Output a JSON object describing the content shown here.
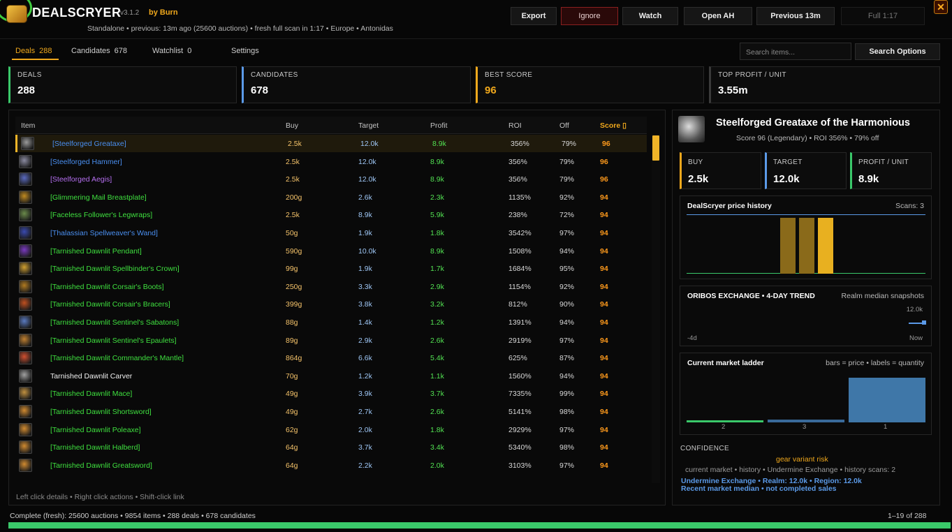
{
  "header": {
    "title": "DEALSCRYER",
    "version": "v3.1.2",
    "author": "by Burn",
    "subtitle": "Standalone • previous: 13m ago (25600 auctions) • fresh full scan in 1:17 • Europe • Antonidas",
    "buttons": {
      "export": "Export",
      "ignore": "Ignore",
      "watch": "Watch",
      "open_ah": "Open AH",
      "previous": "Previous 13m",
      "full": "Full 1:17"
    },
    "close": "✕"
  },
  "tabs": {
    "deals": {
      "label": "Deals",
      "count": "288"
    },
    "candidates": {
      "label": "Candidates",
      "count": "678"
    },
    "watchlist": {
      "label": "Watchlist",
      "count": "0"
    },
    "settings": {
      "label": "Settings"
    }
  },
  "search": {
    "placeholder": "Search items...",
    "options_label": "Search Options"
  },
  "stats": {
    "deals": {
      "label": "DEALS",
      "value": "288"
    },
    "candidates": {
      "label": "CANDIDATES",
      "value": "678"
    },
    "best_score": {
      "label": "BEST SCORE",
      "value": "96"
    },
    "top_profit": {
      "label": "TOP PROFIT / UNIT",
      "value": "3.55m"
    }
  },
  "table": {
    "columns": {
      "item": "Item",
      "buy": "Buy",
      "target": "Target",
      "profit": "Profit",
      "roi": "ROI",
      "off": "Off",
      "score": "Score"
    },
    "sort_indicator": "▯",
    "rows": [
      {
        "name": "[Steelforged Greataxe]",
        "quality": "rare",
        "icon": "greataxe-icon",
        "buy": "2.5k",
        "target": "12.0k",
        "profit": "8.9k",
        "roi": "356%",
        "off": "79%",
        "score": "96"
      },
      {
        "name": "[Steelforged Hammer]",
        "quality": "rare",
        "icon": "hammer-icon",
        "buy": "2.5k",
        "target": "12.0k",
        "profit": "8.9k",
        "roi": "356%",
        "off": "79%",
        "score": "96"
      },
      {
        "name": "[Steelforged Aegis]",
        "quality": "epic",
        "icon": "shield-icon",
        "buy": "2.5k",
        "target": "12.0k",
        "profit": "8.9k",
        "roi": "356%",
        "off": "79%",
        "score": "96"
      },
      {
        "name": "[Glimmering Mail Breastplate]",
        "quality": "uncommon",
        "icon": "breastplate-icon",
        "buy": "200g",
        "target": "2.6k",
        "profit": "2.3k",
        "roi": "1135%",
        "off": "92%",
        "score": "94"
      },
      {
        "name": "[Faceless Follower's Legwraps]",
        "quality": "uncommon",
        "icon": "legwraps-icon",
        "buy": "2.5k",
        "target": "8.9k",
        "profit": "5.9k",
        "roi": "238%",
        "off": "72%",
        "score": "94"
      },
      {
        "name": "[Thalassian Spellweaver's Wand]",
        "quality": "rare",
        "icon": "wand-icon",
        "buy": "50g",
        "target": "1.9k",
        "profit": "1.8k",
        "roi": "3542%",
        "off": "97%",
        "score": "94"
      },
      {
        "name": "[Tarnished Dawnlit Pendant]",
        "quality": "uncommon",
        "icon": "pendant-icon",
        "buy": "590g",
        "target": "10.0k",
        "profit": "8.9k",
        "roi": "1508%",
        "off": "94%",
        "score": "94"
      },
      {
        "name": "[Tarnished Dawnlit Spellbinder's Crown]",
        "quality": "uncommon",
        "icon": "crown-icon",
        "buy": "99g",
        "target": "1.9k",
        "profit": "1.7k",
        "roi": "1684%",
        "off": "95%",
        "score": "94"
      },
      {
        "name": "[Tarnished Dawnlit Corsair's Boots]",
        "quality": "uncommon",
        "icon": "boots-icon",
        "buy": "250g",
        "target": "3.3k",
        "profit": "2.9k",
        "roi": "1154%",
        "off": "92%",
        "score": "94"
      },
      {
        "name": "[Tarnished Dawnlit Corsair's Bracers]",
        "quality": "uncommon",
        "icon": "bracers-icon",
        "buy": "399g",
        "target": "3.8k",
        "profit": "3.2k",
        "roi": "812%",
        "off": "90%",
        "score": "94"
      },
      {
        "name": "[Tarnished Dawnlit Sentinel's Sabatons]",
        "quality": "uncommon",
        "icon": "sabatons-icon",
        "buy": "88g",
        "target": "1.4k",
        "profit": "1.2k",
        "roi": "1391%",
        "off": "94%",
        "score": "94"
      },
      {
        "name": "[Tarnished Dawnlit Sentinel's Epaulets]",
        "quality": "uncommon",
        "icon": "epaulets-icon",
        "buy": "89g",
        "target": "2.9k",
        "profit": "2.6k",
        "roi": "2919%",
        "off": "97%",
        "score": "94"
      },
      {
        "name": "[Tarnished Dawnlit Commander's Mantle]",
        "quality": "uncommon",
        "icon": "mantle-icon",
        "buy": "864g",
        "target": "6.6k",
        "profit": "5.4k",
        "roi": "625%",
        "off": "87%",
        "score": "94"
      },
      {
        "name": "Tarnished Dawnlit Carver",
        "quality": "common",
        "icon": "carver-icon",
        "buy": "70g",
        "target": "1.2k",
        "profit": "1.1k",
        "roi": "1560%",
        "off": "94%",
        "score": "94"
      },
      {
        "name": "[Tarnished Dawnlit Mace]",
        "quality": "uncommon",
        "icon": "mace-icon",
        "buy": "49g",
        "target": "3.9k",
        "profit": "3.7k",
        "roi": "7335%",
        "off": "99%",
        "score": "94"
      },
      {
        "name": "[Tarnished Dawnlit Shortsword]",
        "quality": "uncommon",
        "icon": "shortsword-icon",
        "buy": "49g",
        "target": "2.7k",
        "profit": "2.6k",
        "roi": "5141%",
        "off": "98%",
        "score": "94"
      },
      {
        "name": "[Tarnished Dawnlit Poleaxe]",
        "quality": "uncommon",
        "icon": "poleaxe-icon",
        "buy": "62g",
        "target": "2.0k",
        "profit": "1.8k",
        "roi": "2929%",
        "off": "97%",
        "score": "94"
      },
      {
        "name": "[Tarnished Dawnlit Halberd]",
        "quality": "uncommon",
        "icon": "halberd-icon",
        "buy": "64g",
        "target": "3.7k",
        "profit": "3.4k",
        "roi": "5340%",
        "off": "98%",
        "score": "94"
      },
      {
        "name": "[Tarnished Dawnlit Greatsword]",
        "quality": "uncommon",
        "icon": "greatsword-icon",
        "buy": "64g",
        "target": "2.2k",
        "profit": "2.0k",
        "roi": "3103%",
        "off": "97%",
        "score": "94"
      }
    ],
    "hint": "Left click details  •  Right click actions  •  Shift-click link"
  },
  "detail": {
    "name": "Steelforged Greataxe of the Harmonious",
    "subtitle": "Score 96 (Legendary)  •  ROI 356%  •  79% off",
    "stats": {
      "buy": {
        "label": "BUY",
        "value": "2.5k"
      },
      "target": {
        "label": "TARGET",
        "value": "12.0k"
      },
      "profit": {
        "label": "PROFIT / UNIT",
        "value": "8.9k"
      }
    },
    "price_history": {
      "title": "DealScryer price history",
      "scans": "Scans: 3",
      "bar_levels": [
        1.0,
        1.0,
        1.0
      ]
    },
    "trend": {
      "title": "ORIBOS EXCHANGE • 4-DAY TREND",
      "note": "Realm median snapshots",
      "top_value": "12.0k",
      "start": "-4d",
      "end": "Now"
    },
    "ladder": {
      "title": "Current market ladder",
      "note": "bars = price • labels = quantity",
      "bars": [
        {
          "label": "2",
          "level": 0.05
        },
        {
          "label": "3",
          "level": 0.06
        },
        {
          "label": "1",
          "level": 1.0
        }
      ]
    },
    "confidence": {
      "title": "CONFIDENCE",
      "risk": "gear variant risk",
      "sources": "current market • history • Undermine Exchange  •  history scans: 2",
      "undermine": "Undermine Exchange • Realm: 12.0k • Region: 12.0k",
      "median": "Recent market median • not completed sales"
    }
  },
  "footer": {
    "status": "Complete (fresh): 25600 auctions • 9854 items • 288 deals • 678 candidates",
    "pager": "1–19 of 288",
    "progress": 1.0
  },
  "colors": {
    "accent": "#f0a81c",
    "deals": "#3ac86a",
    "candidates": "#5b9ae8",
    "score": "#f0a81c",
    "profit": "#3ac86a"
  }
}
